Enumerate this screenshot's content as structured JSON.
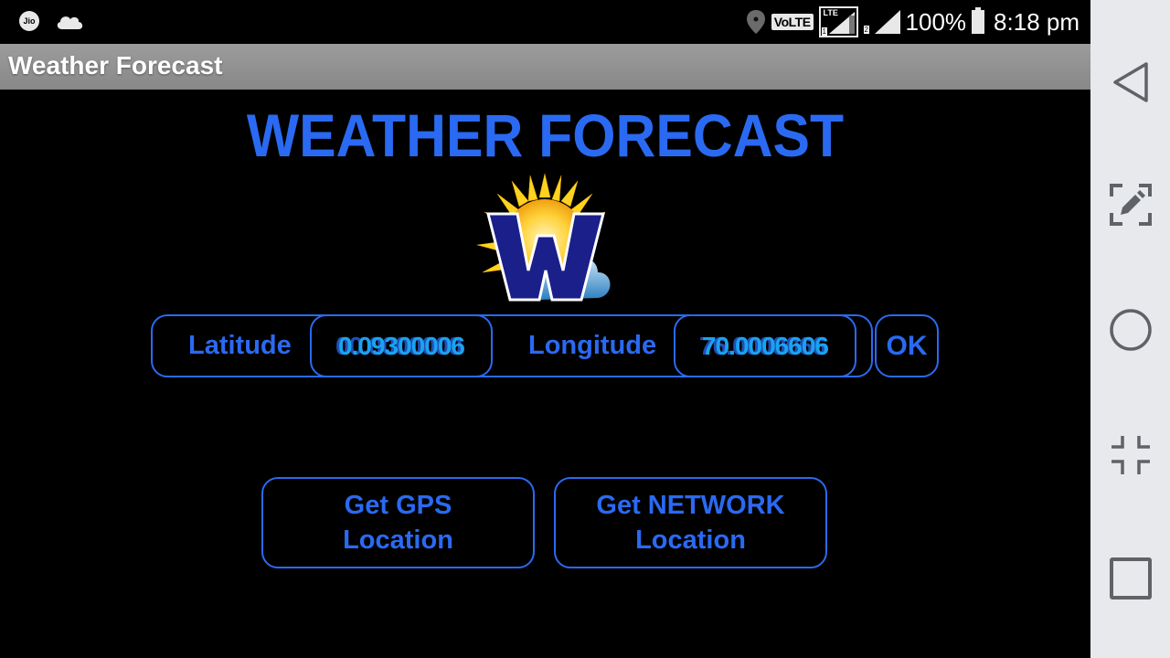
{
  "status_bar": {
    "carrier_icon_label": "Jio",
    "icons_left": [
      "jio-icon",
      "cloud-icon"
    ],
    "icons_right": [
      "location-pin-icon",
      "volte-icon",
      "lte-signal-icon",
      "signal-icon",
      "battery-icon"
    ],
    "volte_label": "VoLTE",
    "lte_label": "LTE",
    "sim1_label": "1",
    "sim2_label": "2",
    "battery_percent": "100%",
    "time": "8:18 pm"
  },
  "action_bar": {
    "title": "Weather Forecast"
  },
  "main": {
    "heading": "WEATHER FORECAST",
    "logo_icon": "weather-w-logo-icon",
    "latitude_label": "Latitude",
    "latitude_value": "0.09300006",
    "latitude_value_overlap": "00.0000000",
    "longitude_label": "Longitude",
    "longitude_value": "70.0006606",
    "longitude_value_overlap": "76.0000066",
    "ok_label": "OK",
    "gps_button": {
      "line1": "Get GPS",
      "line2": "Location"
    },
    "network_button": {
      "line1": "Get NETWORK",
      "line2": "Location"
    }
  },
  "nav_bar": {
    "items": [
      "back-icon",
      "screenshot-edit-icon",
      "home-icon",
      "exit-fullscreen-icon",
      "recents-icon"
    ]
  },
  "colors": {
    "accent": "#2a6af2",
    "field_text": "#1aa3f0",
    "background": "#000000",
    "action_bar": "#949494",
    "nav_bar": "#e8e9ec"
  }
}
